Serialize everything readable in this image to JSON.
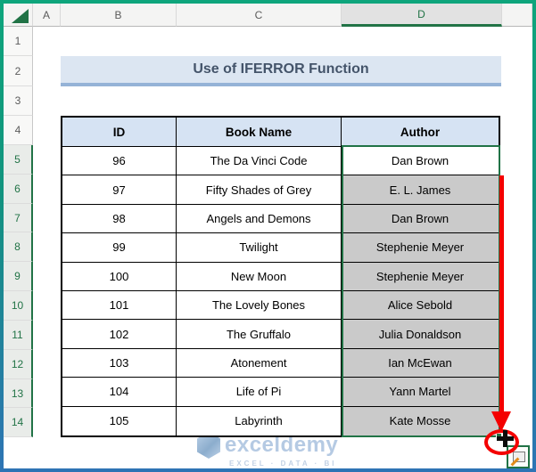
{
  "grid": {
    "column_letters": [
      "A",
      "B",
      "C",
      "D"
    ],
    "selected_column": "D",
    "row_numbers": [
      "1",
      "2",
      "3",
      "4",
      "5",
      "6",
      "7",
      "8",
      "9",
      "10",
      "11",
      "12",
      "13",
      "14"
    ],
    "selected_rows": [
      "5",
      "6",
      "7",
      "8",
      "9",
      "10",
      "11",
      "12",
      "13",
      "14"
    ],
    "selected_range": "D5:D14"
  },
  "title": {
    "text": "Use of IFERROR Function"
  },
  "table": {
    "headers": {
      "id": "ID",
      "book": "Book Name",
      "author": "Author"
    },
    "rows": [
      {
        "id": "96",
        "book": "The Da Vinci Code",
        "author": "Dan Brown"
      },
      {
        "id": "97",
        "book": "Fifty Shades of Grey",
        "author": "E. L. James"
      },
      {
        "id": "98",
        "book": "Angels and Demons",
        "author": "Dan Brown"
      },
      {
        "id": "99",
        "book": "Twilight",
        "author": "Stephenie Meyer"
      },
      {
        "id": "100",
        "book": "New Moon",
        "author": "Stephenie Meyer"
      },
      {
        "id": "101",
        "book": "The Lovely Bones",
        "author": "Alice Sebold"
      },
      {
        "id": "102",
        "book": "The Gruffalo",
        "author": "Julia Donaldson"
      },
      {
        "id": "103",
        "book": "Atonement",
        "author": "Ian McEwan"
      },
      {
        "id": "104",
        "book": "Life of Pi",
        "author": "Yann Martel"
      },
      {
        "id": "105",
        "book": "Labyrinth",
        "author": "Kate Mosse"
      }
    ]
  },
  "watermark": {
    "brand": "exceldemy",
    "tagline": "EXCEL · DATA · BI"
  },
  "icons": {
    "select_all": "select-all-triangle-icon",
    "fill_handle_cursor": "fill-handle-plus-icon",
    "autofill_options": "autofill-options-icon",
    "red_arrow": "red-down-arrow-annotation"
  },
  "colors": {
    "frame_top": "#0EA57C",
    "frame_bottom": "#2E74B5",
    "excel_green": "#217346",
    "arrow_red": "#F40000",
    "table_header_bg": "#D6E3F3",
    "title_bg": "#DCE6F2",
    "title_text": "#44546A",
    "selected_cell_fill": "#CACACA"
  }
}
